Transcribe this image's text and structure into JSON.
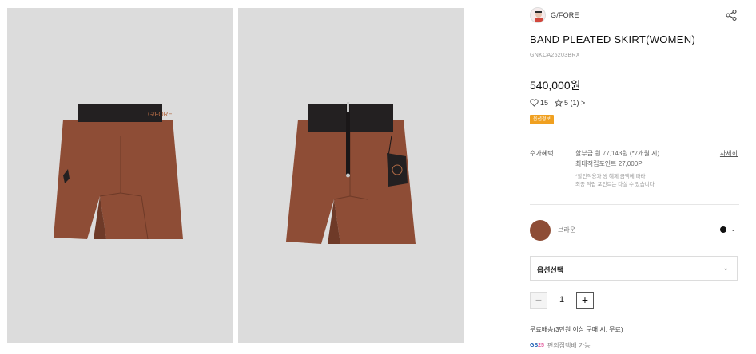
{
  "images": {
    "front_brand_text": "G/FORE",
    "skirt_color": "#8e4d36",
    "waistband_color": "#232021",
    "background": "#dcdcdc"
  },
  "brand": {
    "name": "G/FORE",
    "logo_icon": "brand-avatar-icon",
    "share_icon": "share-icon"
  },
  "product": {
    "title": "BAND PLEATED SKIRT(WOMEN)",
    "code": "GNKCA25203BRX",
    "price": "540,000원"
  },
  "stats": {
    "likes": "15",
    "rating": "5 (1) >"
  },
  "badge": "옵션정보",
  "benefits": {
    "label": "수가혜택",
    "installment": "할부금 원 77,143원 (*7개월 시)",
    "points": "최대적립포인트 27,000P",
    "note_line1": "*할인적용과 쌍 혜제 금액에 따라",
    "note_line2": "최종 적립 포인트는 다실 수 있습니다.",
    "more_link": "자세히"
  },
  "color_option": {
    "name": "브라운",
    "swatch": "#8e4d36",
    "dot": "#111111",
    "chevron": "⌄"
  },
  "option_select": {
    "label": "옵션선택",
    "chevron": "⌄"
  },
  "quantity": {
    "minus": "−",
    "value": "1",
    "plus": "+"
  },
  "shipping": {
    "text": "무료배송(3만원 이상 구매 시, 무료)",
    "pickup_logo_a": "GS",
    "pickup_logo_b": "25",
    "pickup_text": "편의점택배 가능"
  }
}
